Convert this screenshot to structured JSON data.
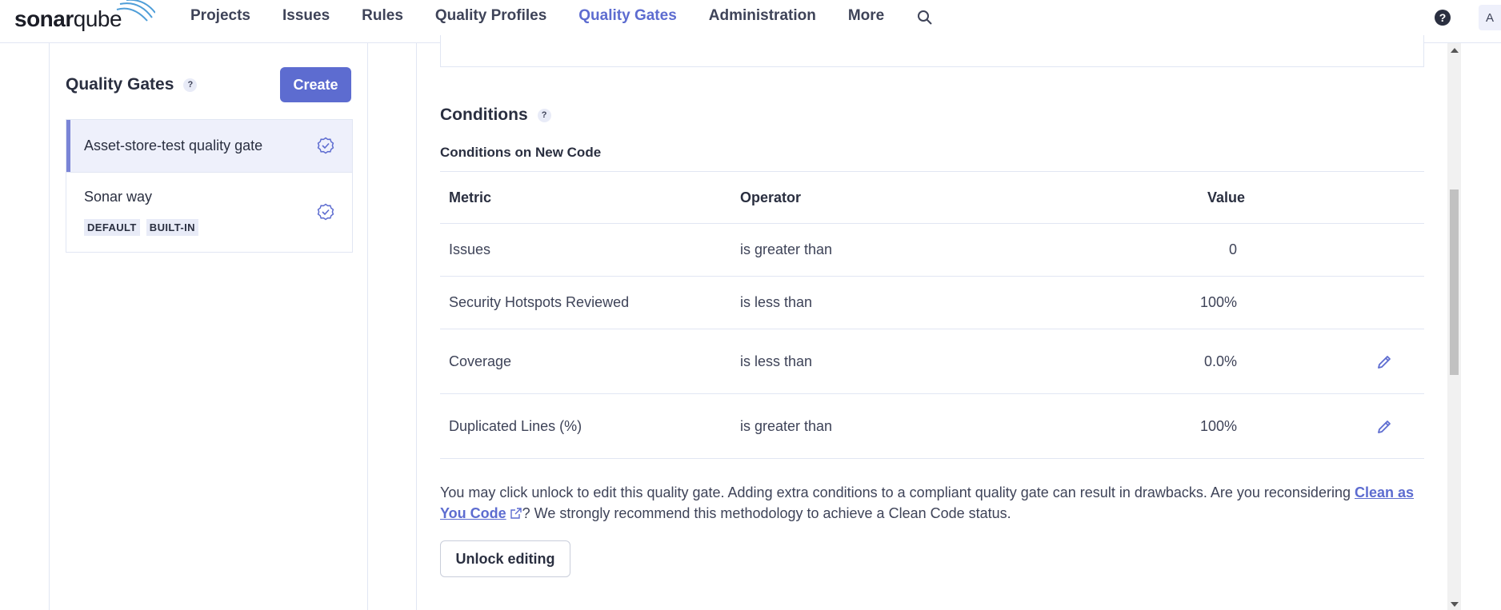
{
  "app": {
    "logo_text_bold": "sonar",
    "logo_text_light": "qube",
    "avatar_letter": "A"
  },
  "nav": {
    "items": [
      {
        "label": "Projects"
      },
      {
        "label": "Issues"
      },
      {
        "label": "Rules"
      },
      {
        "label": "Quality Profiles"
      },
      {
        "label": "Quality Gates",
        "active": true
      },
      {
        "label": "Administration"
      },
      {
        "label": "More"
      }
    ],
    "search_icon": "search-icon",
    "help_icon": "help-icon"
  },
  "sidebar": {
    "title": "Quality Gates",
    "help_glyph": "?",
    "create_label": "Create",
    "gates": [
      {
        "name": "Asset-store-test quality gate",
        "selected": true,
        "badges": []
      },
      {
        "name": "Sonar way",
        "selected": false,
        "badges": [
          "DEFAULT",
          "BUILT-IN"
        ]
      }
    ]
  },
  "main": {
    "conditions_title": "Conditions",
    "help_glyph": "?",
    "new_code_title": "Conditions on New Code",
    "table": {
      "headers": {
        "metric": "Metric",
        "operator": "Operator",
        "value": "Value"
      },
      "rows": [
        {
          "metric": "Issues",
          "operator": "is greater than",
          "value": "0",
          "editable": false
        },
        {
          "metric": "Security Hotspots Reviewed",
          "operator": "is less than",
          "value": "100%",
          "editable": false
        },
        {
          "metric": "Coverage",
          "operator": "is less than",
          "value": "0.0%",
          "editable": true
        },
        {
          "metric": "Duplicated Lines (%)",
          "operator": "is greater than",
          "value": "100%",
          "editable": true
        }
      ]
    },
    "notice_part1": "You may click unlock to edit this quality gate. Adding extra conditions to a compliant quality gate can result in drawbacks. Are you reconsidering ",
    "notice_link": "Clean as You Code",
    "notice_part2": "? We strongly recommend this methodology to achieve a Clean Code status.",
    "unlock_label": "Unlock editing"
  },
  "colors": {
    "accent": "#5d6cd0",
    "selected_bg": "#eef0fb",
    "border": "#e1e6f3"
  }
}
